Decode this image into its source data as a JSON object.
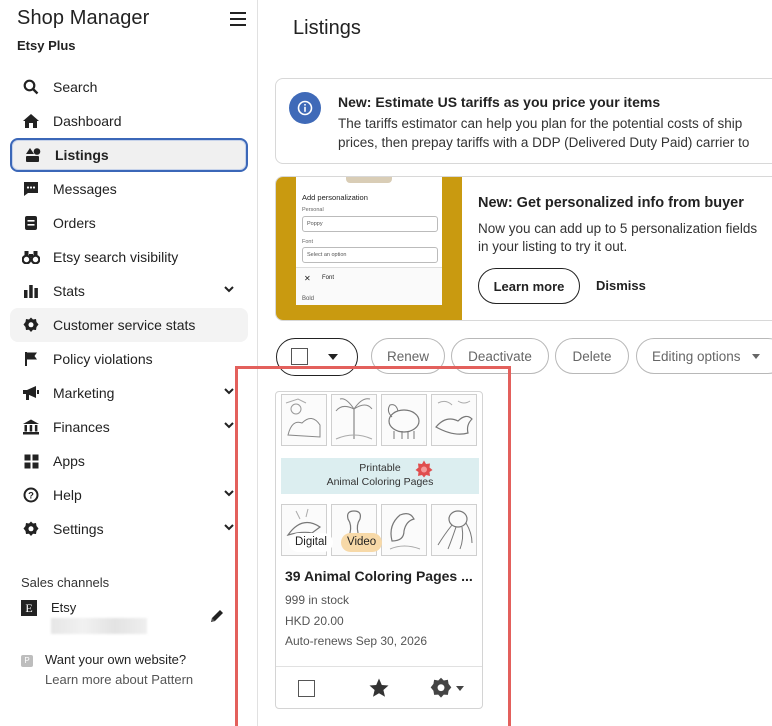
{
  "sidebar": {
    "title": "Shop Manager",
    "subtitle": "Etsy Plus",
    "items": [
      {
        "label": "Search",
        "icon": "search-icon"
      },
      {
        "label": "Dashboard",
        "icon": "home-icon"
      },
      {
        "label": "Listings",
        "icon": "listings-icon",
        "active": true
      },
      {
        "label": "Messages",
        "icon": "message-icon"
      },
      {
        "label": "Orders",
        "icon": "orders-icon"
      },
      {
        "label": "Etsy search visibility",
        "icon": "binoculars-icon"
      },
      {
        "label": "Stats",
        "icon": "stats-icon",
        "expandable": true
      },
      {
        "label": "Customer service stats",
        "icon": "badge-icon"
      },
      {
        "label": "Policy violations",
        "icon": "flag-icon"
      },
      {
        "label": "Marketing",
        "icon": "megaphone-icon",
        "expandable": true
      },
      {
        "label": "Finances",
        "icon": "bank-icon",
        "expandable": true
      },
      {
        "label": "Apps",
        "icon": "apps-icon"
      },
      {
        "label": "Help",
        "icon": "help-icon",
        "expandable": true
      },
      {
        "label": "Settings",
        "icon": "settings-icon",
        "expandable": true
      }
    ],
    "channels_title": "Sales channels",
    "etsy_channel": {
      "letter": "E",
      "name": "Etsy"
    },
    "pattern": {
      "line1": "Want your own website?",
      "line2": "Learn more about Pattern",
      "letter": "P"
    }
  },
  "main": {
    "title": "Listings",
    "tariff_notice": {
      "title": "New: Estimate US tariffs as you price your items",
      "line1": "The tariffs estimator can help you plan for the potential costs of ship",
      "line2": "prices, then prepay tariffs with a DDP (Delivered Duty Paid) carrier to"
    },
    "promo": {
      "title": "New: Get personalized info from buyer",
      "line1": "Now you can add up to 5 personalization fields",
      "line2": "in your listing to try it out.",
      "learn_more": "Learn more",
      "dismiss": "Dismiss",
      "mock": {
        "heading": "Add personalization",
        "label1": "Personal",
        "value1": "Poppy",
        "label2": "Font",
        "value2": "Select an option",
        "sheet_item": "Font",
        "sheet_item2": "Bold"
      }
    },
    "toolbar": {
      "renew": "Renew",
      "deactivate": "Deactivate",
      "delete": "Delete",
      "editing_options": "Editing options"
    },
    "listing": {
      "banner_line1": "Printable",
      "banner_line2": "Animal Coloring Pages",
      "tag_digital": "Digital",
      "tag_video": "Video",
      "title": "39 Animal Coloring Pages ...",
      "stock": "999 in stock",
      "price": "HKD 20.00",
      "renews": "Auto-renews Sep 30, 2026"
    }
  }
}
